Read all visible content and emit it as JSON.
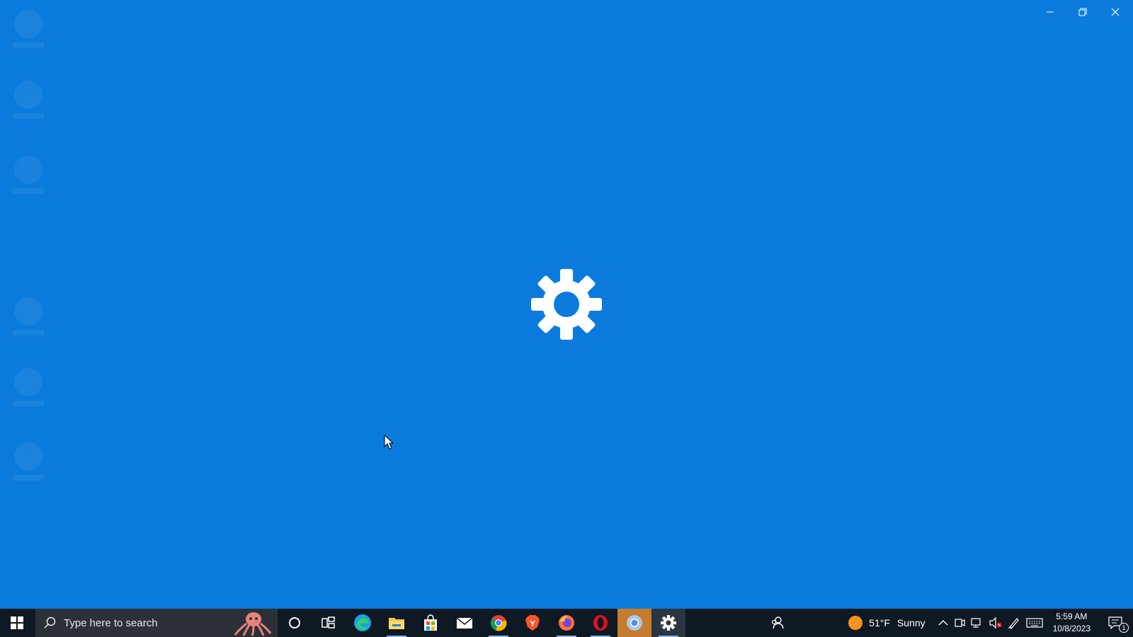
{
  "window": {
    "controls": {
      "minimize": "─",
      "restore": "❐",
      "close": "✕"
    },
    "splash_icon": "gear-icon",
    "background_color": "#0a7bdc"
  },
  "taskbar": {
    "start_icon": "windows-logo-icon",
    "search": {
      "placeholder": "Type here to search",
      "icon": "search-icon"
    },
    "apps": [
      {
        "name": "cortana",
        "icon": "circle-icon"
      },
      {
        "name": "task-view",
        "icon": "task-view-icon"
      },
      {
        "name": "edge",
        "icon": "edge-icon"
      },
      {
        "name": "file-explorer",
        "icon": "folder-icon"
      },
      {
        "name": "microsoft-store",
        "icon": "store-icon"
      },
      {
        "name": "mail",
        "icon": "mail-icon"
      },
      {
        "name": "chrome",
        "icon": "chrome-icon"
      },
      {
        "name": "brave",
        "icon": "brave-icon"
      },
      {
        "name": "firefox",
        "icon": "firefox-icon"
      },
      {
        "name": "opera",
        "icon": "opera-icon"
      },
      {
        "name": "chromium",
        "icon": "chromium-icon"
      },
      {
        "name": "settings",
        "icon": "gear-icon"
      }
    ],
    "tray": {
      "weather_temp": "51°F",
      "weather_condition": "Sunny",
      "time": "5:59 AM",
      "date": "10/8/2023",
      "notification_count": "1"
    }
  }
}
